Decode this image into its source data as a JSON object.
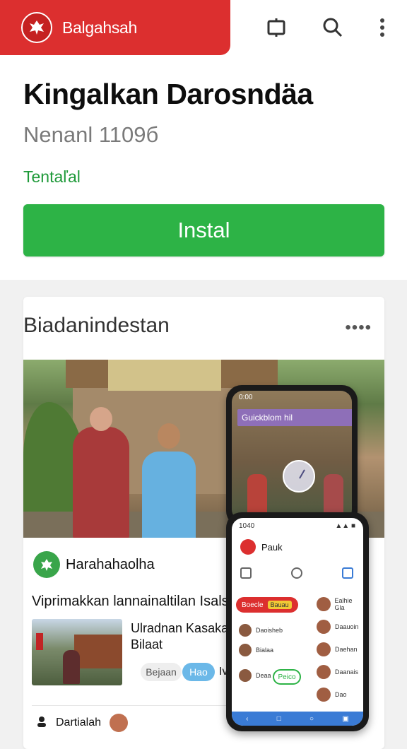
{
  "topbar": {
    "brand_name": "Balgahsah",
    "icons": [
      "bookmark-icon",
      "search-icon",
      "more-vertical-icon"
    ]
  },
  "app": {
    "title": "Kingalkan Darosndäa",
    "subtitle": "Nenanl 1109б",
    "status": "Tentaľal",
    "install_label": "Instal"
  },
  "card": {
    "heading": "Biadanindestan",
    "dots": "••••",
    "post": {
      "author": "Harahahaolha",
      "text": "Viprimakkan lannainaltilan Isalsar",
      "side_title_1": "Ulradnan Kasakarl",
      "side_title_2": "Bilaat",
      "chip_a": "Bejaan",
      "chip_b": "Hao",
      "chip_c": "Iv"
    },
    "bottom_label": "Dartialah"
  },
  "phone1": {
    "status": "0:00",
    "bar_label": "Guickblom hil"
  },
  "phone2": {
    "status_left": "1040",
    "status_right": "▲▲ ■",
    "header_title": "Pauk",
    "pill_label": "Boecle",
    "pill_tag": "Bauau",
    "green_btn": "Peico",
    "left_items": [
      "Daoisheb",
      "Bialaa",
      "Deaa"
    ],
    "right_items": [
      "Ealhie Gla",
      "Daauoin",
      "Daehan",
      "Daanais",
      "Dao"
    ]
  },
  "colors": {
    "brand_red": "#dc2f2f",
    "install_green": "#2db346",
    "status_green": "#1f9a3a"
  }
}
